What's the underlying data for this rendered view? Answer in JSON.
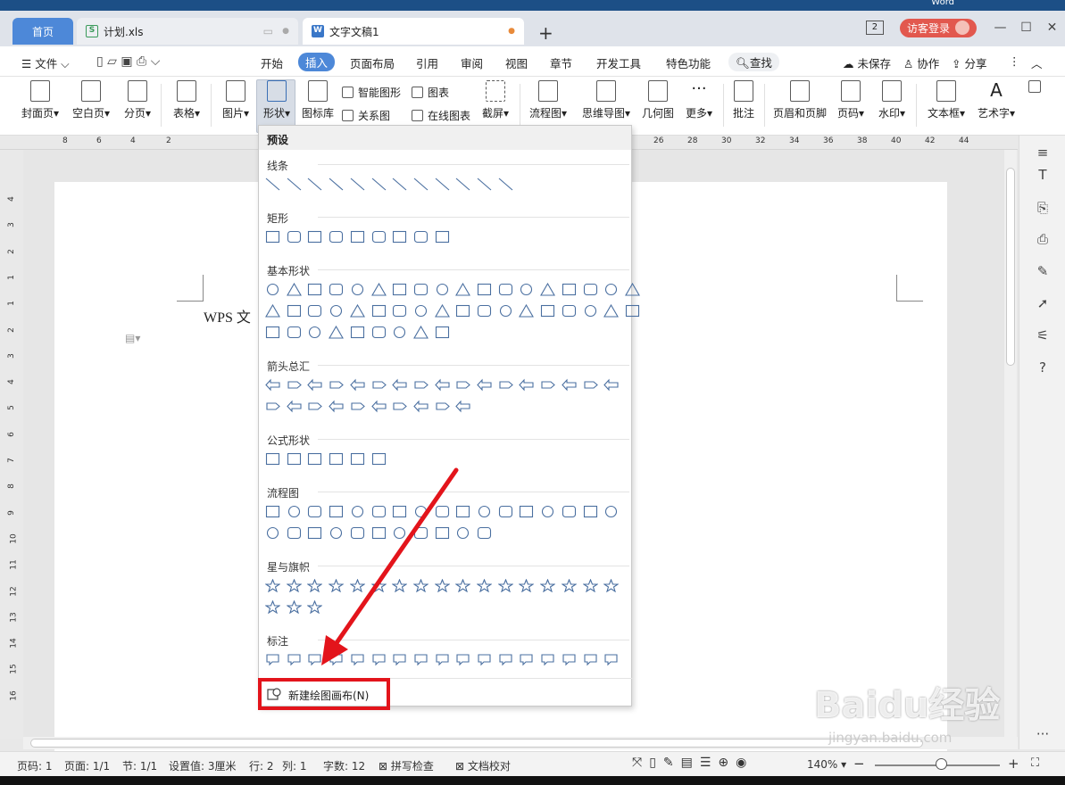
{
  "window": {
    "corner_label": "Word",
    "doc_count": "2",
    "login": "访客登录"
  },
  "tabs": {
    "home": "首页",
    "xls": "计划.xls",
    "doc": "文字文稿1",
    "new": "+"
  },
  "menu": {
    "file": "文件",
    "items": [
      "开始",
      "插入",
      "页面布局",
      "引用",
      "审阅",
      "视图",
      "章节",
      "开发工具",
      "特色功能"
    ],
    "search": "查找",
    "unsaved": "未保存",
    "collab": "协作",
    "share": "分享"
  },
  "toolbar": {
    "cover": "封面页",
    "blank": "空白页",
    "pagebreak": "分页",
    "table": "表格",
    "picture": "图片",
    "shape": "形状",
    "iconlib": "图标库",
    "smartart": "智能图形",
    "relation": "关系图",
    "chart": "图表",
    "online_chart": "在线图表",
    "screenshot": "截屏",
    "flowchart": "流程图",
    "mindmap": "思维导图",
    "geometry": "几何图",
    "more": "更多",
    "comment": "批注",
    "headerfooter": "页眉和页脚",
    "pagenum": "页码",
    "watermark": "水印",
    "textbox": "文本框",
    "wordart": "艺术字"
  },
  "ruler": {
    "left": [
      "8",
      "6",
      "4",
      "2"
    ],
    "right": [
      "26",
      "28",
      "30",
      "32",
      "34",
      "36",
      "38",
      "40",
      "42",
      "44"
    ],
    "vertical": [
      "4",
      "3",
      "2",
      "1",
      "1",
      "2",
      "3",
      "4",
      "5",
      "6",
      "7",
      "8",
      "9",
      "10",
      "11",
      "12",
      "13",
      "14",
      "15",
      "16"
    ]
  },
  "document": {
    "text": "WPS 文"
  },
  "dropdown": {
    "header": "预设",
    "categories": [
      "线条",
      "矩形",
      "基本形状",
      "箭头总汇",
      "公式形状",
      "流程图",
      "星与旗帜",
      "标注"
    ],
    "new_canvas": "新建绘图画布(N)"
  },
  "status": {
    "page": "页码: 1",
    "pages": "页面: 1/1",
    "section": "节: 1/1",
    "setting": "设置值: 3厘米",
    "row": "行: 2",
    "col": "列: 1",
    "words": "字数: 12",
    "spell": "拼写检查",
    "proof": "文档校对",
    "zoom": "140%",
    "minus": "−",
    "plus": "+"
  },
  "watermark": {
    "brand": "Baidu经验",
    "url": "jingyan.baidu.com"
  },
  "colors": {
    "accent": "#4d88d8",
    "login": "#e2584e",
    "highlight": "#e3141b",
    "shape_stroke": "#4a6fa0"
  }
}
